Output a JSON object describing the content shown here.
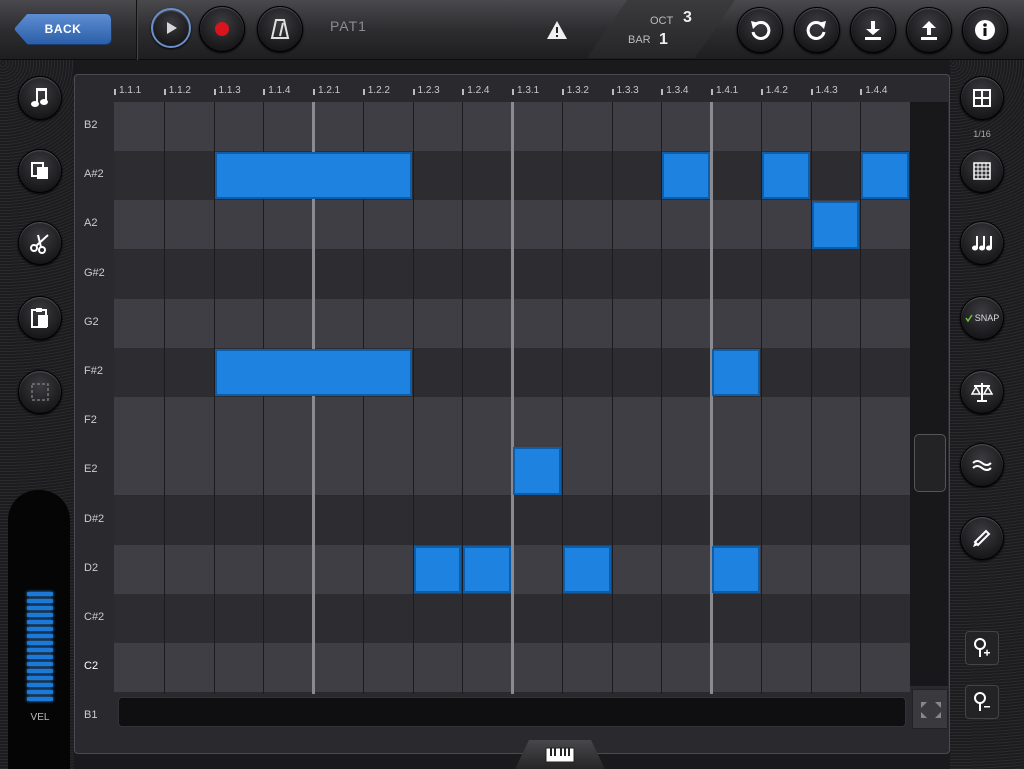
{
  "app": {
    "back_label": "BACK",
    "pattern_name": "PAT1",
    "position": {
      "oct_label": "OCT",
      "oct_value": "3",
      "bar_label": "BAR",
      "bar_value": "1"
    },
    "grid_resolution": "1/16",
    "snap_label": "SNAP",
    "velocity_label": "VEL",
    "accent_color": "#1d82e0"
  },
  "toolbar": {
    "icons": [
      "play-icon",
      "record-icon",
      "metronome-icon",
      "warning-icon",
      "undo-icon",
      "redo-icon",
      "download-icon",
      "upload-icon",
      "info-icon"
    ]
  },
  "left_tools": [
    "note-icon",
    "copy-icon",
    "scissors-icon",
    "paste-icon",
    "select-icon"
  ],
  "right_tools": [
    "grid-icon",
    "grid-fine-icon",
    "notes-icon",
    "snap-icon",
    "balance-icon",
    "wave-icon",
    "pencil-icon",
    "zoom-in-icon",
    "zoom-out-icon"
  ],
  "ruler": [
    "1.1.1",
    "1.1.2",
    "1.1.3",
    "1.1.4",
    "1.2.1",
    "1.2.2",
    "1.2.3",
    "1.2.4",
    "1.3.1",
    "1.3.2",
    "1.3.3",
    "1.3.4",
    "1.4.1",
    "1.4.2",
    "1.4.3",
    "1.4.4"
  ],
  "keys": [
    "B2",
    "A#2",
    "A2",
    "G#2",
    "G2",
    "F#2",
    "F2",
    "E2",
    "D#2",
    "D2",
    "C#2",
    "C2",
    "B1"
  ],
  "notes": [
    {
      "pitch": "A#2",
      "start_step": 2,
      "length_steps": 4
    },
    {
      "pitch": "A#2",
      "start_step": 11,
      "length_steps": 1
    },
    {
      "pitch": "A#2",
      "start_step": 13,
      "length_steps": 1
    },
    {
      "pitch": "A#2",
      "start_step": 15,
      "length_steps": 1
    },
    {
      "pitch": "A2",
      "start_step": 14,
      "length_steps": 1
    },
    {
      "pitch": "F#2",
      "start_step": 2,
      "length_steps": 4
    },
    {
      "pitch": "F#2",
      "start_step": 12,
      "length_steps": 1
    },
    {
      "pitch": "E2",
      "start_step": 8,
      "length_steps": 1
    },
    {
      "pitch": "D2",
      "start_step": 6,
      "length_steps": 1
    },
    {
      "pitch": "D2",
      "start_step": 7,
      "length_steps": 1
    },
    {
      "pitch": "D2",
      "start_step": 9,
      "length_steps": 1
    },
    {
      "pitch": "D2",
      "start_step": 12,
      "length_steps": 1
    }
  ]
}
